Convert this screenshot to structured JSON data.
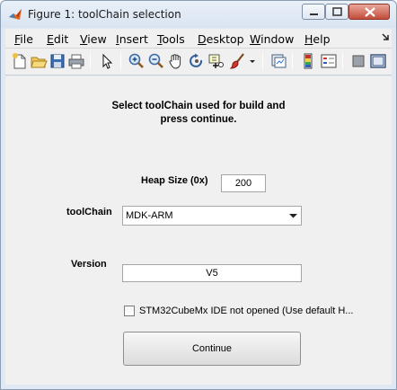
{
  "window": {
    "title": "Figure 1: toolChain selection"
  },
  "menu": {
    "items": [
      {
        "label": "File",
        "u": "F",
        "rest": "ile"
      },
      {
        "label": "Edit",
        "u": "E",
        "rest": "dit"
      },
      {
        "label": "View",
        "u": "V",
        "rest": "iew"
      },
      {
        "label": "Insert",
        "u": "I",
        "rest": "nsert"
      },
      {
        "label": "Tools",
        "u": "T",
        "rest": "ools"
      },
      {
        "label": "Desktop",
        "u": "D",
        "rest": "esktop"
      },
      {
        "label": "Window",
        "u": "W",
        "rest": "indow"
      },
      {
        "label": "Help",
        "u": "H",
        "rest": "elp"
      }
    ],
    "overflow_icon": "menu-overflow-arrow-icon"
  },
  "toolbar": {
    "icons": [
      "new-figure-icon",
      "open-file-icon",
      "save-icon",
      "print-icon",
      "select-pointer-icon",
      "zoom-in-icon",
      "zoom-out-icon",
      "pan-hand-icon",
      "rotate-3d-icon",
      "data-cursor-icon",
      "brush-icon",
      "brush-dropdown-icon",
      "link-plot-icon",
      "insert-colorbar-icon",
      "insert-legend-icon",
      "hide-plot-tools-icon",
      "show-plot-tools-icon"
    ]
  },
  "form": {
    "prompt_line1": "Select toolChain used for build and",
    "prompt_line2": "press continue.",
    "heap_label": "Heap Size (0x)",
    "heap_value": "200",
    "toolchain_label": "toolChain",
    "toolchain_value": "MDK-ARM",
    "version_label": "Version",
    "version_value": "V5",
    "checkbox_label": "STM32CubeMx IDE not opened (Use default H...",
    "checkbox_checked": false,
    "continue_label": "Continue"
  }
}
